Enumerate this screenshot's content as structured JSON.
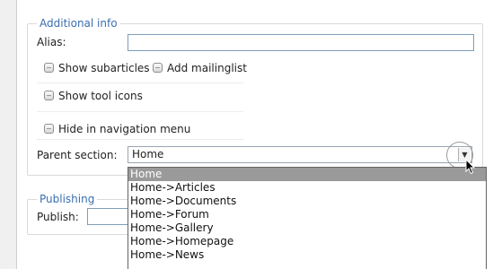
{
  "additional_info": {
    "legend": "Additional info",
    "alias_label": "Alias:",
    "alias_value": "",
    "show_subarticles_label": "Show subarticles",
    "add_mailinglist_label": "Add mailinglist",
    "show_tool_icons_label": "Show tool icons",
    "hide_in_nav_label": "Hide in navigation menu",
    "parent_section_label": "Parent section:",
    "parent_section_value": "Home"
  },
  "publishing": {
    "legend": "Publishing",
    "publish_label": "Publish:"
  },
  "parent_section_options": [
    "Home",
    "Home->Articles",
    "Home->Documents",
    "Home->Forum",
    "Home->Gallery",
    "Home->Homepage",
    "Home->News"
  ],
  "selected_option_index": 0,
  "icons": {
    "dropdown_arrow": "chevron-down-icon",
    "cursor": "mouse-pointer-icon"
  },
  "colors": {
    "legend": "#3a6fb0",
    "selected_option_bg": "#9a9a9a",
    "input_border": "#7f9db9"
  }
}
